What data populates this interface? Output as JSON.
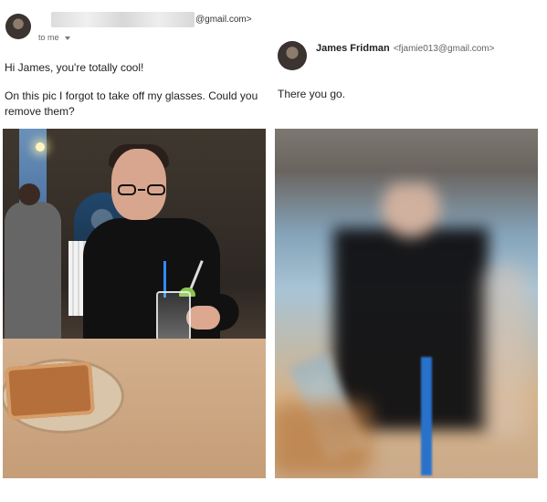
{
  "left_message": {
    "sender_domain": "@gmail.com>",
    "to_label": "to me",
    "greeting": "Hi James, you're totally cool!",
    "body": "On this pic I forgot to take off my glasses. Could you remove them?"
  },
  "right_message": {
    "sender_name": "James Fridman",
    "sender_email": "<fjamie013@gmail.com>",
    "body": "There you go."
  },
  "icons": {
    "left_avatar": "person-avatar-icon",
    "right_avatar": "person-avatar-icon",
    "to_dropdown": "chevron-down-icon"
  },
  "colors": {
    "text_primary": "#202124",
    "text_secondary": "#5f6368",
    "straw_blue": "#2f8cff"
  }
}
